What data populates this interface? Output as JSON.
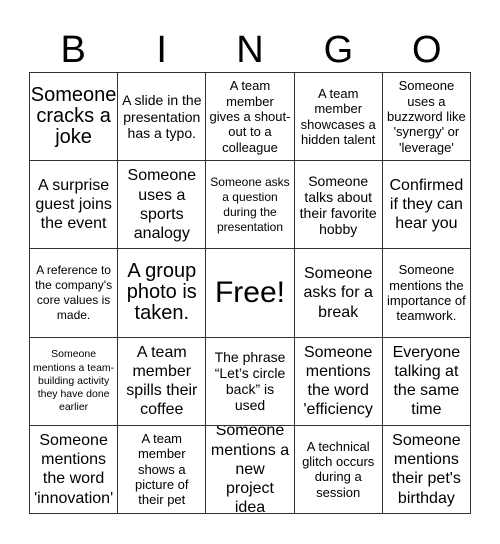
{
  "header": {
    "letters": [
      "B",
      "I",
      "N",
      "G",
      "O"
    ]
  },
  "board": {
    "cells": [
      "Someone cracks a joke",
      "A slide in the presentation has a typo.",
      "A team member gives a shout-out to a colleague",
      "A team member showcases a hidden talent",
      "Someone uses a buzzword like 'synergy' or 'leverage'",
      "A surprise guest joins the event",
      "Someone uses a sports analogy",
      "Someone asks a question during the presentation",
      "Someone talks about their favorite hobby",
      "Confirmed if they can hear you",
      "A reference to the company's core values is made.",
      "A group photo is taken.",
      "Free!",
      "Someone asks for a break",
      "Someone mentions the importance of teamwork.",
      "Someone mentions a team-building activity they have done earlier",
      "A team member spills their coffee",
      "The phrase “Let’s circle back” is used",
      "Someone mentions the word 'efficiency",
      "Everyone talking at the same time",
      "Someone mentions the word 'innovation'",
      "A team member shows a picture of their pet",
      "Someone mentions a new project idea",
      "A technical glitch occurs during a session",
      "Someone mentions their pet's birthday"
    ]
  }
}
